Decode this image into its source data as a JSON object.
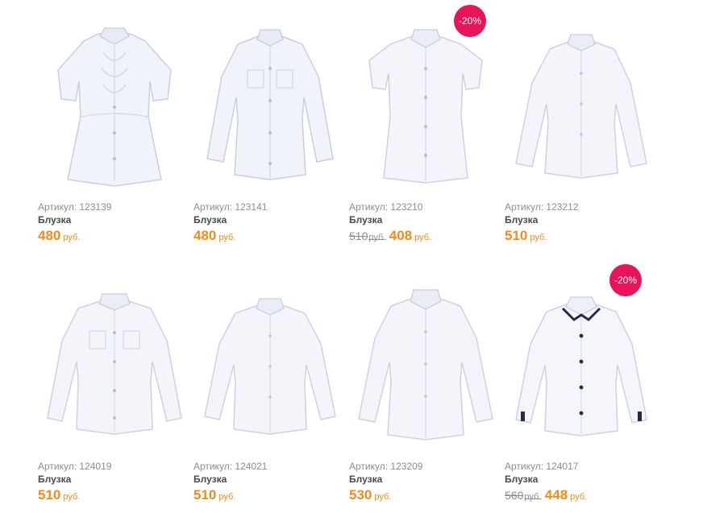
{
  "products": [
    {
      "sku_label": "Артикул: 123139",
      "name": "Блузка",
      "old_price": "",
      "old_currency": "",
      "price": "480",
      "currency": "руб.",
      "badge": ""
    },
    {
      "sku_label": "Артикул: 123141",
      "name": "Блузка",
      "old_price": "",
      "old_currency": "",
      "price": "480",
      "currency": "руб.",
      "badge": ""
    },
    {
      "sku_label": "Артикул: 123210",
      "name": "Блузка",
      "old_price": "510",
      "old_currency": "руб.",
      "price": "408",
      "currency": "руб.",
      "badge": "-20%"
    },
    {
      "sku_label": "Артикул: 123212",
      "name": "Блузка",
      "old_price": "",
      "old_currency": "",
      "price": "510",
      "currency": "руб.",
      "badge": ""
    },
    {
      "sku_label": "Артикул: 124019",
      "name": "Блузка",
      "old_price": "",
      "old_currency": "",
      "price": "510",
      "currency": "руб.",
      "badge": ""
    },
    {
      "sku_label": "Артикул: 124021",
      "name": "Блузка",
      "old_price": "",
      "old_currency": "",
      "price": "510",
      "currency": "руб.",
      "badge": ""
    },
    {
      "sku_label": "Артикул: 123209",
      "name": "Блузка",
      "old_price": "",
      "old_currency": "",
      "price": "530",
      "currency": "руб.",
      "badge": ""
    },
    {
      "sku_label": "Артикул: 124017",
      "name": "Блузка",
      "old_price": "560",
      "old_currency": "руб.",
      "price": "448",
      "currency": "руб.",
      "badge": "-20%"
    }
  ],
  "colors": {
    "price": "#f28a1a",
    "badge": "#e8145a",
    "sku": "#8c8c8c",
    "name": "#4a4a4a"
  },
  "icons": [
    "shirt-short-sleeve-ruffle",
    "shirt-long-sleeve-pockets",
    "shirt-cap-sleeve",
    "shirt-long-sleeve",
    "shirt-long-sleeve-pockets",
    "shirt-long-sleeve",
    "shirt-long-sleeve",
    "shirt-long-sleeve-navy-trim"
  ]
}
